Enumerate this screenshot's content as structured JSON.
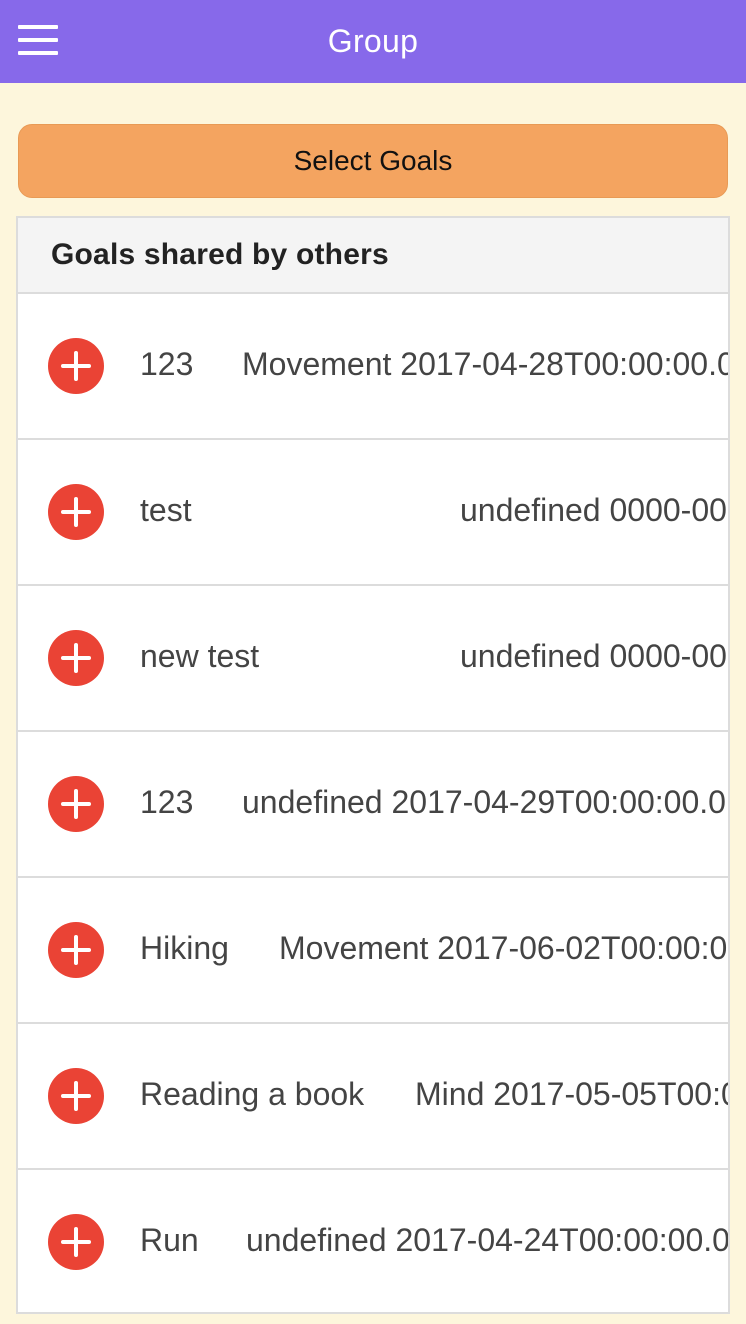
{
  "header": {
    "title": "Group",
    "menu_icon": "hamburger-menu-icon"
  },
  "select_goals_label": "Select Goals",
  "list": {
    "heading": "Goals shared by others",
    "items": [
      {
        "name": "123",
        "detail": "Movement 2017-04-28T00:00:00.0"
      },
      {
        "name": "test",
        "detail": "undefined 0000-00"
      },
      {
        "name": "new test",
        "detail": "undefined 0000-00"
      },
      {
        "name": "123",
        "detail": "undefined 2017-04-29T00:00:00.0"
      },
      {
        "name": "Hiking",
        "detail": "Movement 2017-06-02T00:00:0"
      },
      {
        "name": "Reading a book",
        "detail": "Mind 2017-05-05T00:0"
      },
      {
        "name": "Run",
        "detail": "undefined 2017-04-24T00:00:00.0"
      }
    ]
  },
  "colors": {
    "header_bg": "#8769ea",
    "page_bg": "#fdf6dc",
    "select_button_bg": "#f4a460",
    "add_icon": "#ea4335"
  }
}
